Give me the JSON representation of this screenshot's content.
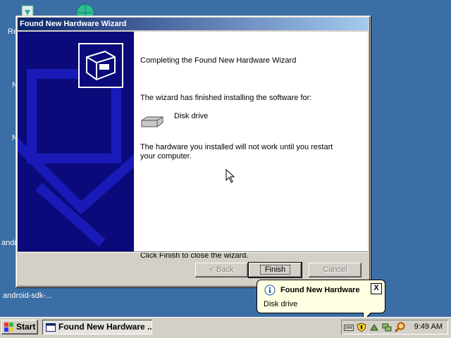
{
  "desktop": {
    "icons_partial": [
      "Re",
      "N",
      "N",
      "andr"
    ],
    "folder_label": "android-sdk-..."
  },
  "wizard": {
    "title": "Found New Hardware Wizard",
    "heading": "Completing the Found New Hardware Wizard",
    "finished_text": "The wizard has finished installing the software for:",
    "device_name": "Disk drive",
    "device_icon": "disk-drive-icon",
    "restart_text_line1": "The hardware you installed will not work until you restart",
    "restart_text_line2": "your computer.",
    "close_text": "Click Finish to close the wizard.",
    "buttons": {
      "back": "< Back",
      "finish": "Finish",
      "cancel": "Cancel"
    }
  },
  "balloon": {
    "title": "Found New Hardware",
    "message": "Disk drive",
    "close": "X"
  },
  "taskbar": {
    "start_label": "Start",
    "task_label": "Found New Hardware ...",
    "clock": "9:49 AM"
  },
  "colors": {
    "desktop": "#3a6ea5",
    "titlebar_start": "#0a246a",
    "wizard_side": "#0a0a7a",
    "balloon_bg": "#ffffe1"
  }
}
